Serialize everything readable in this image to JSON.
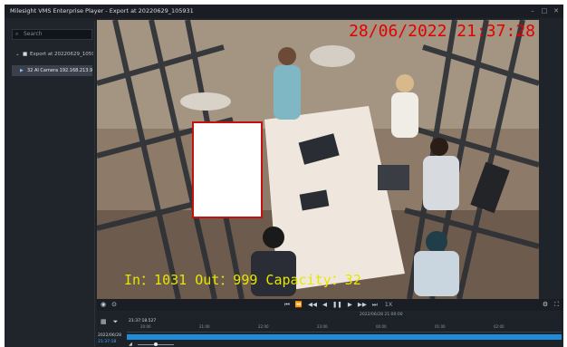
{
  "window": {
    "title": "Milesight VMS Enterprise Player - Export at 20220629_105931",
    "controls": [
      "–",
      "□",
      "✕"
    ]
  },
  "sidebar": {
    "search_placeholder": "Search",
    "tree": {
      "root_label": "Export at 20220629_1059...",
      "child_label": "32 AI Camera 192.168.213.97"
    }
  },
  "video": {
    "osd_timestamp": "28/06/2022 21:37:28",
    "osd_counter": "In：1031 Out：999 Capacity：32"
  },
  "controls": {
    "speed": "1X",
    "icons": [
      "snapshot-icon",
      "record-icon",
      "skip-start-icon",
      "prev-frame-icon",
      "rewind-icon",
      "step-back-icon",
      "pause-icon",
      "step-forward-icon",
      "fast-forward-icon",
      "skip-end-icon"
    ]
  },
  "timeline": {
    "center_date": "2022/06/28 21:00:00",
    "cursor_time": "21:37:18.527",
    "date": "2022/06/28",
    "time": "21:37:18",
    "tick_labels": [
      "20:00",
      "21:00",
      "22:00",
      "23:00",
      "00:00",
      "01:00",
      "02:00"
    ]
  },
  "colors": {
    "osd_time": "#e30000",
    "osd_counter": "#e6e600",
    "record_bar": "#1e8cd8",
    "mask_border": "#c61010"
  }
}
